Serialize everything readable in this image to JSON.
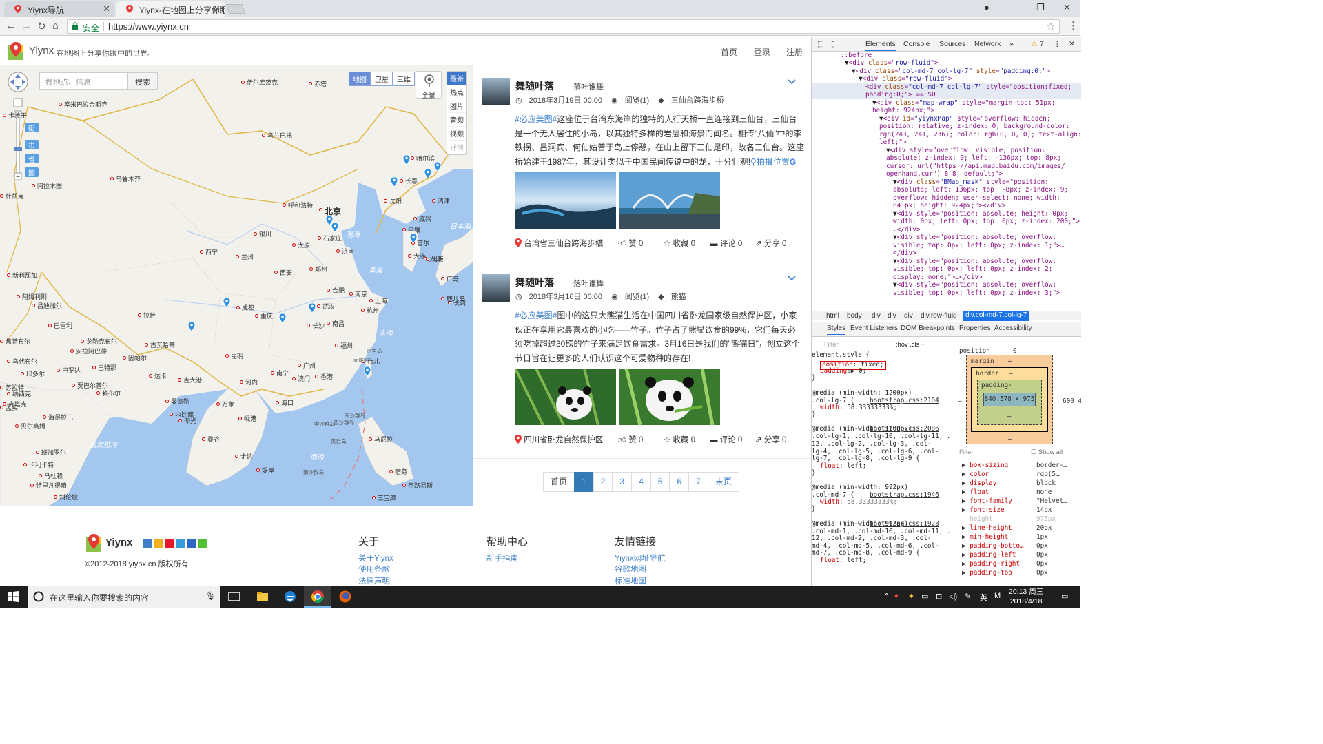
{
  "browser": {
    "tabs": [
      {
        "title": "Yiynx导航"
      },
      {
        "title": "Yiynx-在地图上分享你眼"
      }
    ],
    "secure_label": "安全",
    "url": "https://www.yiynx.cn"
  },
  "site": {
    "brand": "Yiynx",
    "slogan": "在地图上分享你眼中的世界。",
    "nav": [
      "首页",
      "登录",
      "注册"
    ]
  },
  "map": {
    "search_placeholder": "搜地点、信息",
    "search_button": "搜索",
    "types": [
      "地图",
      "卫星",
      "三维"
    ],
    "panorama": "全景",
    "categories": [
      "最新",
      "热点",
      "图片",
      "音频",
      "视频",
      "评情"
    ],
    "zoom_levels": [
      "街",
      "市",
      "省",
      "国"
    ],
    "cities": [
      "伊尔库茨克",
      "赤塔",
      "塞米巴拉金斯克",
      "乌兰巴托",
      "卡拉干",
      "乌鲁木齐",
      "哈尔滨",
      "长春",
      "沈阳",
      "阿拉木图",
      "什凯克",
      "呼和浩特",
      "北京",
      "清津",
      "威兴",
      "平壤",
      "首尔",
      "银川",
      "太原",
      "石家庄",
      "大连",
      "西宁",
      "兰州",
      "济南",
      "大邱",
      "西安",
      "郑州",
      "新利那加",
      "合肥",
      "南京",
      "上海",
      "阿姆利则",
      "昌迪加尔",
      "成都",
      "武汉",
      "杭州",
      "拉萨",
      "重庆",
      "长沙",
      "南昌",
      "巴雷利",
      "戈勒克布尔",
      "焦特布尔",
      "古瓦哈蒂",
      "安拉阿巴德",
      "福州",
      "乌代布尔",
      "巴罗达",
      "巴特那",
      "因帕尔",
      "印多尔",
      "达卡",
      "吉大港",
      "昆明",
      "南宁",
      "广州",
      "台北",
      "苏拉特",
      "贾巴尔普尔",
      "赖布尔",
      "曼德勒",
      "河内",
      "澳门",
      "香港",
      "纳西克",
      "克塔克",
      "内比都",
      "海口",
      "孟买",
      "海得拉巴",
      "万象",
      "仰光",
      "贝尔高姆",
      "岘港",
      "马尼拉",
      "班加罗尔",
      "曼谷",
      "金边",
      "卡利卡特",
      "马杜赖",
      "特里凡得琅",
      "堤岸",
      "宿务",
      "三宝颜",
      "斜伦坡",
      "圣路易斯",
      "长崎",
      "广岛",
      "鹿儿岛",
      "大阪"
    ],
    "cities_small": [
      "东沙群岛",
      "西沙群岛",
      "中沙群岛",
      "黄岩岛",
      "南沙群岛",
      "钓鱼岛",
      "赤尾屿"
    ],
    "seas": [
      "渤海",
      "黄海",
      "日本海",
      "东海",
      "南海",
      "孟加拉湾"
    ]
  },
  "posts": [
    {
      "author": "舞随叶落",
      "nickname": "落叶谁舞",
      "date": "2018年3月19日 00:00",
      "views": "阅览(1)",
      "tag": "三仙台跨海步桥",
      "hashtag": "#必应美图#",
      "text": "这座位于台湾东海岸的独特的人行天桥一直连接到三仙台，三仙台是一个无人居住的小岛，以其独特多样的岩层和海景而闻名。相传\"八仙\"中的李铁拐、吕洞宾、何仙姑曾于岛上停憩，在山上留下三仙足印，故名三仙台。这座桥始建于1987年，其设计类似于中国民间传说中的龙，十分壮观!",
      "location_link": "拍摄位置",
      "location": "台湾省三仙台跨海步橋",
      "likes": "赞 0",
      "favorites": "收藏 0",
      "comments": "评论 0",
      "shares": "分享 0"
    },
    {
      "author": "舞随叶落",
      "nickname": "落叶谁舞",
      "date": "2018年3月16日 00:00",
      "views": "阅览(1)",
      "tag": "熊猫",
      "hashtag": "#必应美图#",
      "text": "图中的这只大熊猫生活在中国四川省卧龙国家级自然保护区，小家伙正在享用它最喜欢的小吃——竹子。竹子占了熊猫饮食的99%，它们每天必须吃掉超过30磅的竹子来满足饮食需求。3月16日是我们的\"熊猫日\"，创立这个节日旨在让更多的人们认识这个可爱物种的存在!",
      "location": "四川省卧龙自然保护区",
      "likes": "赞 0",
      "favorites": "收藏 0",
      "comments": "评论 0",
      "shares": "分享 0"
    }
  ],
  "pager": [
    "首页",
    "1",
    "2",
    "3",
    "4",
    "5",
    "6",
    "7",
    "末页"
  ],
  "footer": {
    "brand": "Yiynx",
    "copyright": "©2012-2018 yiynx.cn 版权所有",
    "about_title": "关于",
    "about_links": [
      "关于Yiynx",
      "使用条款",
      "法律声明"
    ],
    "help_title": "帮助中心",
    "help_links": [
      "新手指南"
    ],
    "friends_title": "友情链接",
    "friends_links": [
      "Yiynx网址导航",
      "谷歌地图",
      "标准地图"
    ]
  },
  "devtools": {
    "tabs": [
      "Elements",
      "Console",
      "Sources",
      "Network",
      "»"
    ],
    "warnings": "7",
    "dom_lines": [
      "<div class=\"row-fluid\">",
      "<div class=\"col-md-7 col-lg-7\" style=\"padding:0;\">",
      "<div class=\"row-fluid\">",
      "<div class=\"col-md-7 col-lg-7\" style=\"position:fixed;",
      "padding:0;\"> == $0",
      "<div class=\"map-wrap\" style=\"margin-top: 51px;",
      "height: 924px;\">",
      "<div id=\"yiynxMap\" style=\"overflow: hidden;",
      "position: relative; z-index: 0; background-color:",
      "rgb(243, 241, 236); color: rgb(0, 0, 0); text-align:",
      "left;\">",
      "<div style=\"overflow: visible; position:",
      "absolute; z-index: 0; left: -136px; top: 8px;",
      "cursor: url(\"https://api.map.baidu.com/images/",
      "openhand.cur\") 8 8, default;\">",
      "<div class=\"BMap_mask\" style=\"position:",
      "absolute; left: 136px; top: -8px; z-index: 9;",
      "overflow: hidden; user-select: none; width:",
      "841px; height: 924px;\"></div>",
      "<div style=\"position: absolute; height: 0px;",
      "width: 0px; left: 0px; top: 0px; z-index: 200;\">",
      "…</div>",
      "<div style=\"position: absolute; overflow:",
      "visible; top: 0px; left: 0px; z-index: 1;\">…",
      "</div>",
      "<div style=\"position: absolute; overflow:",
      "visible; top: 0px; left: 0px; z-index: 2;",
      "display: none;\">…</div>",
      "<div style=\"position: absolute; overflow:",
      "visible; top: 0px; left: 0px; z-index: 3;\">"
    ],
    "breadcrumb": [
      "html",
      "body",
      "div",
      "div",
      "div",
      "div.row-fluid",
      "div.col-md-7.col-lg-7"
    ],
    "subtabs": [
      "Styles",
      "Event Listeners",
      "DOM Breakpoints",
      "Properties",
      "Accessibility"
    ],
    "filter": "Filter",
    "hov_cls": ":hov  .cls  +",
    "style_lines": [
      "element.style {",
      "position: fixed;",
      "padding:▶ 0;",
      "}",
      "@media (min-width: 1200px)",
      ".col-lg-7 {",
      "width: 58.33333333%;",
      "}",
      "@media (min-width: 1200px)",
      ".col-lg-1, .col-lg-10, .col-lg-11, .col-lg-",
      "12, .col-lg-2, .col-lg-3, .col-",
      "lg-4, .col-lg-5, .col-lg-6, .col-",
      "lg-7, .col-lg-8, .col-lg-9 {",
      "float: left;",
      "}",
      "@media (min-width: 992px)",
      ".col-md-7 {",
      "width: 58.33333333%;",
      "}",
      "@media (min-width: 992px)",
      ".col-md-1, .col-md-10, .col-md-11, .col-md-",
      "12, .col-md-2, .col-md-3, .col-",
      "md-4, .col-md-5, .col-md-6, .col-",
      "md-7, .col-md-8, .col-md-9 {",
      "float: left;"
    ],
    "sources": [
      "bootstrap.css:2104",
      "bootstrap.css:2086",
      "bootstrap.css:1946",
      "bootstrap.css:1928"
    ],
    "box": {
      "position": "position",
      "pos_val": "0",
      "margin": "margin",
      "border": "border",
      "padding": "padding-",
      "content": "840.578 × 975",
      "dash": "–",
      "right": "600.4"
    },
    "computed_filter": "Filter",
    "show_all": "Show all",
    "computed": [
      [
        "box-sizing",
        "border-…"
      ],
      [
        "color",
        "rgb(5…"
      ],
      [
        "display",
        "block"
      ],
      [
        "float",
        "none"
      ],
      [
        "font-family",
        "\"Helvet…"
      ],
      [
        "font-size",
        "14px"
      ],
      [
        "height",
        "975px"
      ],
      [
        "line-height",
        "20px"
      ],
      [
        "min-height",
        "1px"
      ],
      [
        "padding-botto…",
        "0px"
      ],
      [
        "padding-left",
        "0px"
      ],
      [
        "padding-right",
        "0px"
      ],
      [
        "padding-top",
        "0px"
      ]
    ]
  },
  "taskbar": {
    "search": "在这里输入你要搜索的内容",
    "time": "20:13 周三",
    "date": "2018/4/18",
    "ime": "英",
    "ime2": "M"
  },
  "colors": {
    "accent": "#337ab7",
    "link": "#3d7fc9",
    "tag": "#3d7fc9",
    "pin": "#e53935",
    "sea": "#a3c7ee"
  }
}
